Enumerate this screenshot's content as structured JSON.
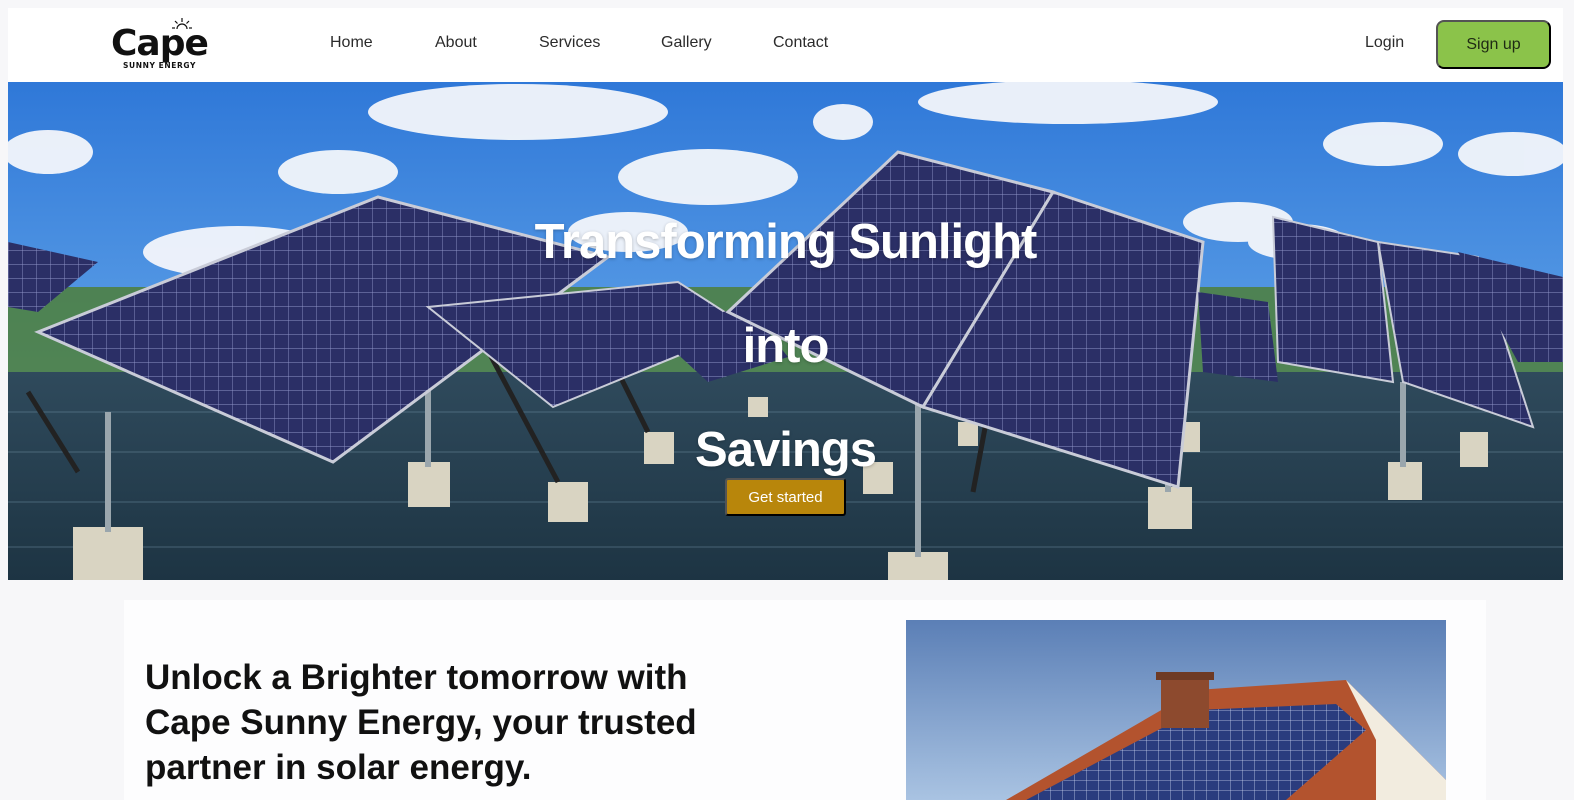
{
  "brand": {
    "name": "Cape",
    "tagline": "SUNNY ENERGY"
  },
  "nav": {
    "items": [
      {
        "label": "Home"
      },
      {
        "label": "About"
      },
      {
        "label": "Services"
      },
      {
        "label": "Gallery"
      },
      {
        "label": "Contact"
      }
    ],
    "login_label": "Login",
    "signup_label": "Sign up"
  },
  "hero": {
    "title_lines": [
      "Transforming Sunlight",
      "into",
      "Savings"
    ],
    "cta_label": "Get started"
  },
  "about": {
    "heading": "Unlock a Brighter tomorrow with Cape Sunny Energy, your trusted partner in solar energy."
  },
  "colors": {
    "accent": "#8bc34a",
    "cta": "#b8860b",
    "sky": "#4a8fe0"
  },
  "icons": {
    "logo_mark": "sun-rays-icon"
  }
}
